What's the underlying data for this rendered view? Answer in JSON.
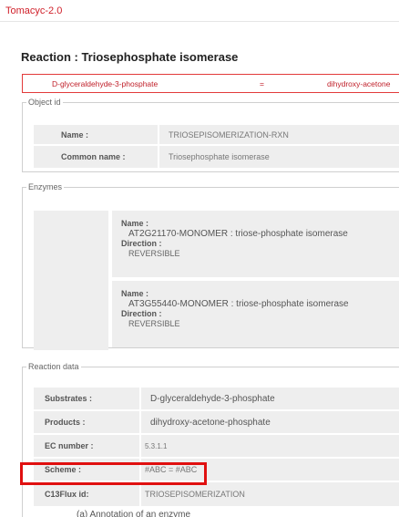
{
  "app": {
    "title": "Tomacyc-2.0"
  },
  "reaction": {
    "title": "Reaction : Triosephosphate isomerase",
    "equation": {
      "left": "D-glyceraldehyde-3-phosphate",
      "operator": "=",
      "right": "dihydroxy-acetone"
    }
  },
  "object_id": {
    "legend": "Object id",
    "rows": [
      {
        "label": "Name :",
        "value": "TRIOSEPISOMERIZATION-RXN"
      },
      {
        "label": "Common name :",
        "value": "Triosephosphate isomerase"
      }
    ]
  },
  "enzymes": {
    "legend": "Enzymes",
    "items": [
      {
        "name_label": "Name :",
        "name": "AT2G21170-MONOMER : triose-phosphate isomerase",
        "direction_label": "Direction :",
        "direction": "REVERSIBLE"
      },
      {
        "name_label": "Name :",
        "name": "AT3G55440-MONOMER : triose-phosphate isomerase",
        "direction_label": "Direction :",
        "direction": "REVERSIBLE"
      }
    ]
  },
  "reaction_data": {
    "legend": "Reaction data",
    "rows": [
      {
        "label": "Substrates :",
        "value": "D-glyceraldehyde-3-phosphate"
      },
      {
        "label": "Products :",
        "value": "dihydroxy-acetone-phosphate"
      },
      {
        "label": "EC number :",
        "value": "5.3.1.1"
      },
      {
        "label": "Scheme :",
        "value": "#ABC = #ABC"
      },
      {
        "label": "C13Flux id:",
        "value": "TRIOSEPISOMERIZATION"
      }
    ]
  },
  "caption": "(a) Annotation of an enzyme"
}
